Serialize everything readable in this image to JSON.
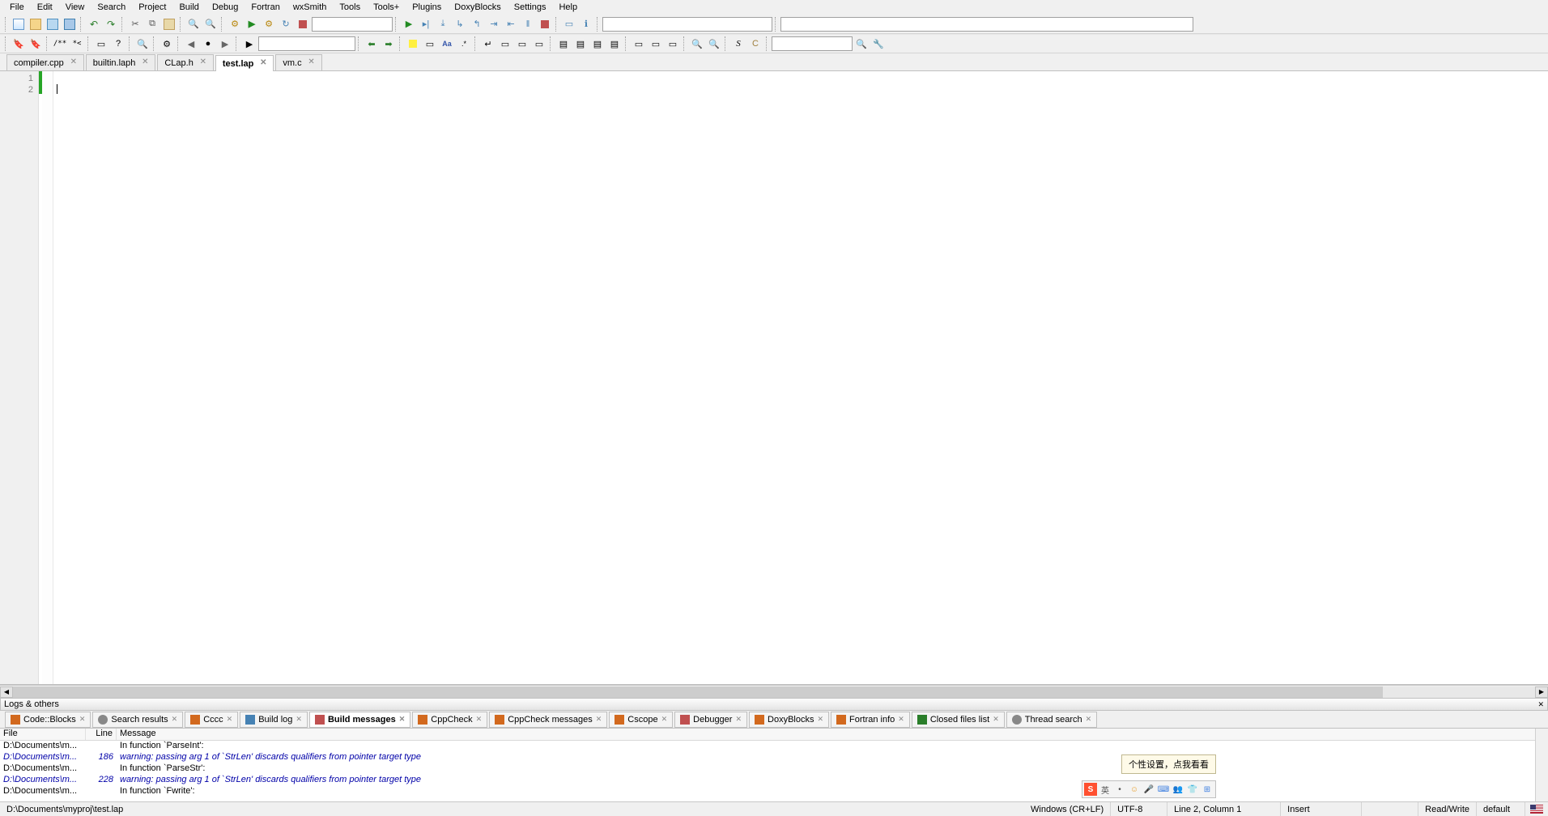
{
  "menu": [
    "File",
    "Edit",
    "View",
    "Search",
    "Project",
    "Build",
    "Debug",
    "Fortran",
    "wxSmith",
    "Tools",
    "Tools+",
    "Plugins",
    "DoxyBlocks",
    "Settings",
    "Help"
  ],
  "editor_tabs": [
    {
      "label": "compiler.cpp",
      "active": false
    },
    {
      "label": "builtin.laph",
      "active": false
    },
    {
      "label": "CLap.h",
      "active": false
    },
    {
      "label": "test.lap",
      "active": true
    },
    {
      "label": "vm.c",
      "active": false
    }
  ],
  "gutter_lines": [
    "1",
    "2"
  ],
  "logs_title": "Logs & others",
  "log_tabs": [
    {
      "label": "Code::Blocks",
      "icon": "orange"
    },
    {
      "label": "Search results",
      "icon": "search"
    },
    {
      "label": "Cccc",
      "icon": "orange"
    },
    {
      "label": "Build log",
      "icon": "blue"
    },
    {
      "label": "Build messages",
      "icon": "red",
      "active": true
    },
    {
      "label": "CppCheck",
      "icon": "orange"
    },
    {
      "label": "CppCheck messages",
      "icon": "orange"
    },
    {
      "label": "Cscope",
      "icon": "orange"
    },
    {
      "label": "Debugger",
      "icon": "red"
    },
    {
      "label": "DoxyBlocks",
      "icon": "orange"
    },
    {
      "label": "Fortran info",
      "icon": "orange"
    },
    {
      "label": "Closed files list",
      "icon": "green"
    },
    {
      "label": "Thread search",
      "icon": "search"
    }
  ],
  "log_columns": {
    "file": "File",
    "line": "Line",
    "message": "Message"
  },
  "build_messages": [
    {
      "file": "D:\\Documents\\m...",
      "line": "",
      "msg": "In function `ParseInt':",
      "warn": false
    },
    {
      "file": "D:\\Documents\\m...",
      "line": "186",
      "msg": "warning: passing arg 1 of `StrLen' discards qualifiers from pointer target type",
      "warn": true
    },
    {
      "file": "D:\\Documents\\m...",
      "line": "",
      "msg": "In function `ParseStr':",
      "warn": false
    },
    {
      "file": "D:\\Documents\\m...",
      "line": "228",
      "msg": "warning: passing arg 1 of `StrLen' discards qualifiers from pointer target type",
      "warn": true
    },
    {
      "file": "D:\\Documents\\m...",
      "line": "",
      "msg": "In function `Fwrite':",
      "warn": false
    }
  ],
  "status": {
    "path": "D:\\Documents\\myproj\\test.lap",
    "eol": "Windows (CR+LF)",
    "encoding": "UTF-8",
    "position": "Line 2, Column 1",
    "insert": "Insert",
    "rw": "Read/Write",
    "profile": "default"
  },
  "ime_tooltip": "个性设置，点我看看",
  "ime_buttons": [
    "S",
    "英",
    "•",
    "☺",
    "🎤",
    "⌨",
    "👥",
    "👕",
    "⊞"
  ]
}
